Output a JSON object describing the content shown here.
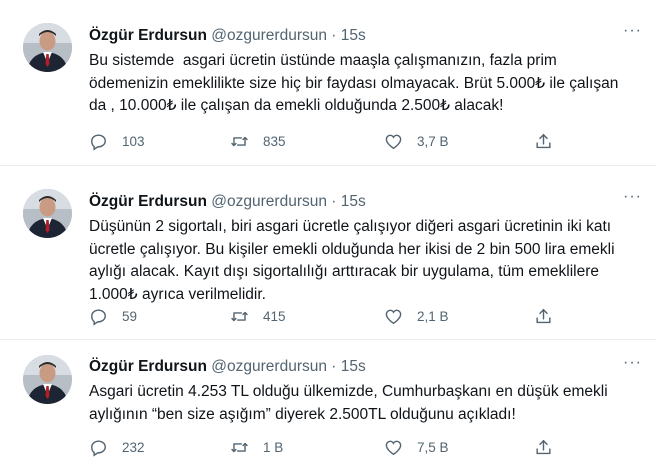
{
  "tweets": [
    {
      "author_name": "Özgür Erdursun",
      "author_handle": "@ozgurerdursun",
      "separator": "·",
      "time": "15s",
      "more": "···",
      "text": "Bu sistemde  asgari ücretin üstünde maaşla çalışmanızın, fazla prim ödemenizin emeklilikte size hiç bir faydası olmayacak. Brüt 5.000₺ ile çalışan da , 10.000₺ ile çalışan da emekli olduğunda 2.500₺ alacak!",
      "replies": "103",
      "retweets": "835",
      "likes": "3,7 B"
    },
    {
      "author_name": "Özgür Erdursun",
      "author_handle": "@ozgurerdursun",
      "separator": "·",
      "time": "15s",
      "more": "···",
      "text": "Düşünün 2 sigortalı, biri asgari ücretle çalışıyor diğeri asgari ücretinin iki katı ücretle çalışıyor. Bu kişiler emekli olduğunda her ikisi de 2 bin 500 lira emekli aylığı alacak. Kayıt dışı sigortalılığı arttıracak bir uygulama, tüm emeklilere 1.000₺ ayrıca verilmelidir.",
      "replies": "59",
      "retweets": "415",
      "likes": "2,1 B"
    },
    {
      "author_name": "Özgür Erdursun",
      "author_handle": "@ozgurerdursun",
      "separator": "·",
      "time": "15s",
      "more": "···",
      "text": "Asgari ücretin 4.253 TL olduğu ülkemizde, Cumhurbaşkanı en düşük emekli aylığının “ben size aşığım” diyerek 2.500TL olduğunu açıkladı!",
      "replies": "232",
      "retweets": "1 B",
      "likes": "7,5 B"
    }
  ],
  "icons": {
    "reply": "reply-icon",
    "retweet": "retweet-icon",
    "like": "like-icon",
    "share": "share-icon"
  },
  "colors": {
    "text": "#0f1419",
    "secondary": "#536471",
    "divider": "#e6ecf0"
  }
}
